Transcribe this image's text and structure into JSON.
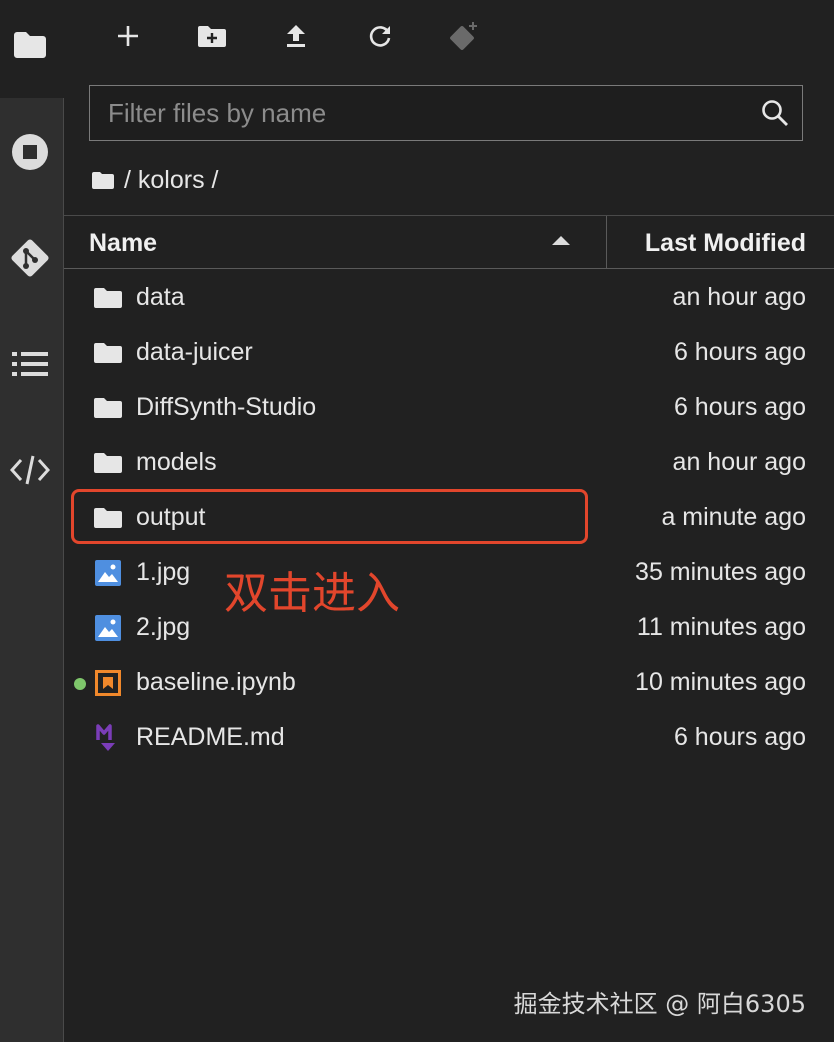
{
  "sidebar": {
    "icons": [
      "folder-icon",
      "stop-circle-icon",
      "git-icon",
      "list-icon",
      "code-icon"
    ]
  },
  "toolbar": {
    "buttons": [
      "new-launcher-icon",
      "new-folder-icon",
      "upload-icon",
      "refresh-icon",
      "git-clone-icon"
    ]
  },
  "filter": {
    "placeholder": "Filter files by name",
    "value": ""
  },
  "breadcrumb": {
    "path": "/ kolors /"
  },
  "header": {
    "name": "Name",
    "last_modified": "Last Modified"
  },
  "files": [
    {
      "name": "data",
      "modified": "an hour ago",
      "type": "folder"
    },
    {
      "name": "data-juicer",
      "modified": "6 hours ago",
      "type": "folder"
    },
    {
      "name": "DiffSynth-Studio",
      "modified": "6 hours ago",
      "type": "folder"
    },
    {
      "name": "models",
      "modified": "an hour ago",
      "type": "folder"
    },
    {
      "name": "output",
      "modified": "a minute ago",
      "type": "folder"
    },
    {
      "name": "1.jpg",
      "modified": "35 minutes ago",
      "type": "image"
    },
    {
      "name": "2.jpg",
      "modified": "11 minutes ago",
      "type": "image"
    },
    {
      "name": "baseline.ipynb",
      "modified": "10 minutes ago",
      "type": "notebook",
      "running": true
    },
    {
      "name": "README.md",
      "modified": "6 hours ago",
      "type": "markdown"
    }
  ],
  "annotation": {
    "text": "双击进入",
    "color": "#e2462c"
  },
  "watermark": "掘金技术社区 @ 阿白6305",
  "colors": {
    "background": "#212121",
    "sidebar": "#2f2f2f",
    "accent_red": "#e2462c",
    "image_blue": "#4f8fe0",
    "notebook_orange": "#f0882b",
    "markdown_purple": "#7b3db8",
    "running_green": "#7ec66b"
  }
}
